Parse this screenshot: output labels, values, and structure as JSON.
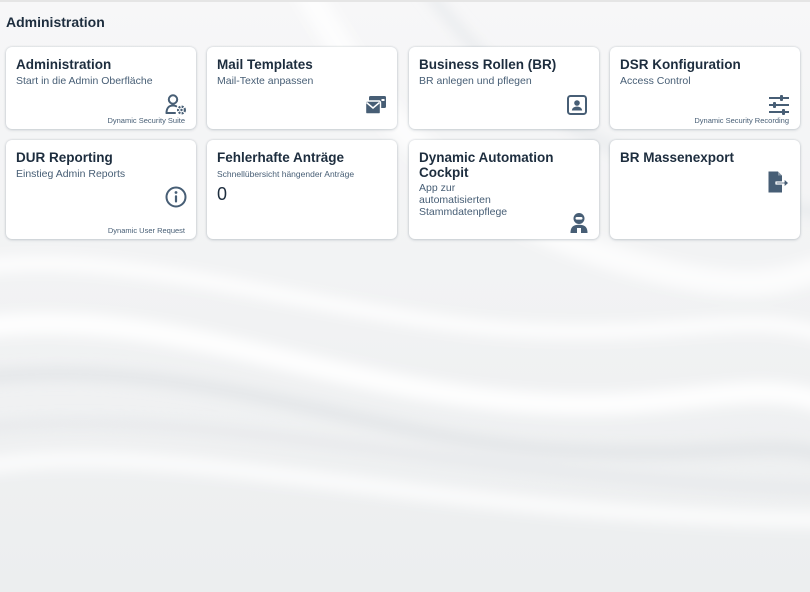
{
  "page": {
    "section_title": "Administration"
  },
  "colors": {
    "text_primary": "#1d2d3e",
    "text_secondary": "#475e75",
    "icon": "#475e75",
    "tile_bg": "#ffffff"
  },
  "tiles": [
    {
      "title": "Administration",
      "subtitle": "Start in die Admin Oberfläche",
      "footer": "Dynamic Security Suite",
      "icon": "user-settings-icon"
    },
    {
      "title": "Mail Templates",
      "subtitle": "Mail-Texte anpassen",
      "footer": "",
      "icon": "mail-template-icon"
    },
    {
      "title": "Business Rollen (BR)",
      "subtitle": "BR anlegen und pflegen",
      "footer": "",
      "icon": "contact-card-icon"
    },
    {
      "title": "DSR Konfiguration",
      "subtitle": "Access Control",
      "footer": "Dynamic Security Recording",
      "icon": "sliders-icon"
    },
    {
      "title": "DUR Reporting",
      "subtitle": "Einstieg Admin Reports",
      "footer": "Dynamic User Request",
      "icon": "info-icon"
    },
    {
      "title": "Fehlerhafte Anträge",
      "subtitle": "Schnellübersicht hängender Anträge",
      "kpi": "0",
      "footer": "",
      "icon": ""
    },
    {
      "title": "Dynamic Automation Cockpit",
      "subtitle": "App zur automatisierten Stammdatenpflege",
      "footer": "",
      "icon": "robot-icon"
    },
    {
      "title": "BR Massenexport",
      "subtitle": "",
      "footer": "",
      "icon": "export-document-icon"
    }
  ]
}
